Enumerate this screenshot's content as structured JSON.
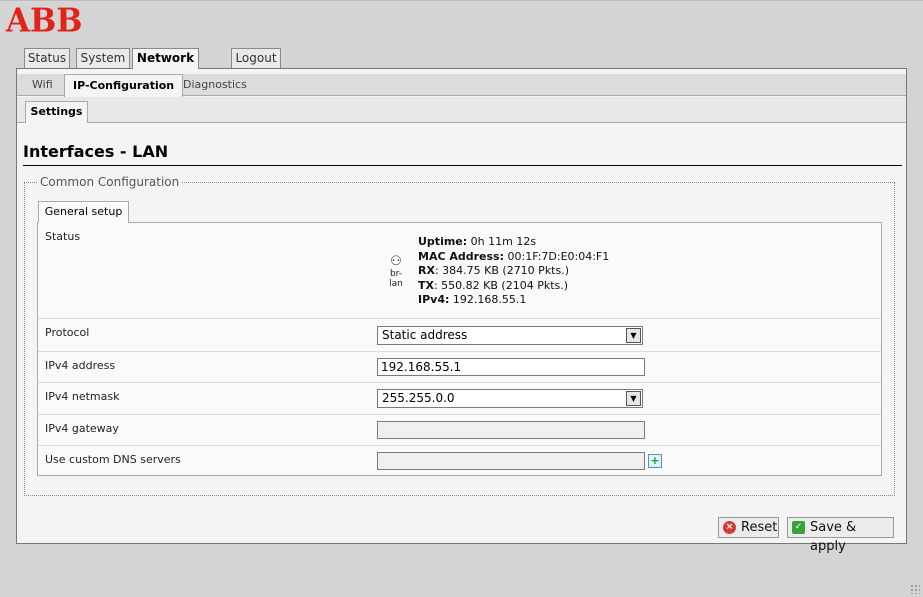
{
  "brand": {
    "logo_text": "ABB",
    "logo_color": "#e2231a"
  },
  "main_tabs": [
    {
      "label": "Status",
      "active": false
    },
    {
      "label": "System",
      "active": false
    },
    {
      "label": "Network",
      "active": true
    },
    {
      "label": "Logout",
      "active": false
    }
  ],
  "sub_tabs": [
    {
      "label": "Wifi",
      "active": false
    },
    {
      "label": "IP-Configuration",
      "active": true
    },
    {
      "label": "Diagnostics",
      "active": false
    }
  ],
  "settings_tab": "Settings",
  "page_title": "Interfaces - LAN",
  "section": {
    "legend": "Common Configuration",
    "inner_tab": "General setup",
    "status": {
      "label": "Status",
      "icon": "network-interface-icon",
      "icon_caption": "br-lan",
      "uptime_label": "Uptime:",
      "uptime_value": "0h 11m 12s",
      "mac_label": "MAC Address:",
      "mac_value": "00:1F:7D:E0:04:F1",
      "rx_label": "RX",
      "rx_value": ": 384.75 KB (2710 Pkts.)",
      "tx_label": "TX",
      "tx_value": ": 550.82 KB (2104 Pkts.)",
      "ipv4_label": "IPv4:",
      "ipv4_value": "192.168.55.1"
    },
    "fields": {
      "protocol": {
        "label": "Protocol",
        "value": "Static address"
      },
      "ipv4_address": {
        "label": "IPv4 address",
        "value": "192.168.55.1"
      },
      "ipv4_netmask": {
        "label": "IPv4 netmask",
        "value": "255.255.0.0"
      },
      "ipv4_gateway": {
        "label": "IPv4 gateway",
        "value": ""
      },
      "custom_dns": {
        "label": "Use custom DNS servers",
        "value": ""
      }
    }
  },
  "buttons": {
    "reset": "Reset",
    "save_apply": "Save & apply"
  }
}
